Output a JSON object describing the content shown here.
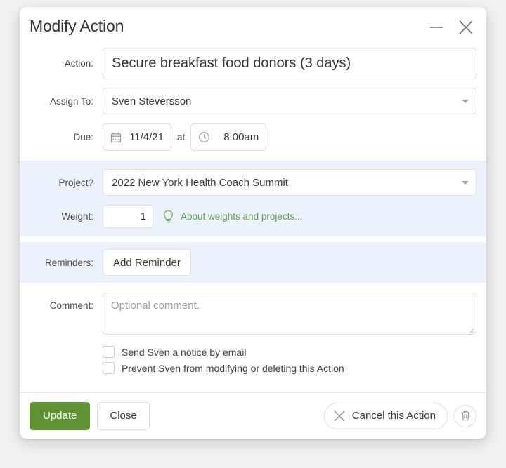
{
  "dialog": {
    "title": "Modify Action",
    "minimize_icon": "minimize-icon",
    "close_icon": "close-icon"
  },
  "fields": {
    "action": {
      "label": "Action:",
      "value": "Secure breakfast food donors (3 days)",
      "placeholder": ""
    },
    "assign_to": {
      "label": "Assign To:",
      "value": "Sven Steversson",
      "caret_icon": "chevron-down-icon"
    },
    "due": {
      "label": "Due:",
      "date_value": "11/4/21",
      "date_icon": "calendar-icon",
      "separator": "at",
      "time_value": "8:00am",
      "time_icon": "clock-icon"
    },
    "project": {
      "label": "Project?",
      "value": "2022 New York Health Coach Summit",
      "caret_icon": "chevron-down-icon"
    },
    "weight": {
      "label": "Weight:",
      "value": "1",
      "bulb_icon": "lightbulb-icon",
      "hint_link": "About weights and projects...",
      "hint_color": "#58a14f"
    },
    "reminders": {
      "label": "Reminders:",
      "add_button": "Add Reminder"
    },
    "comment": {
      "label": "Comment:",
      "value": "",
      "placeholder": "Optional comment."
    }
  },
  "checkboxes": [
    {
      "label": "Send Sven a notice by email",
      "checked": false
    },
    {
      "label": "Prevent Sven from modifying or deleting this Action",
      "checked": false
    }
  ],
  "footer": {
    "update_label": "Update",
    "update_color": "#5f9233",
    "close_label": "Close",
    "cancel_label": "Cancel this Action",
    "cancel_icon": "close-x-icon",
    "trash_icon": "trash-icon"
  }
}
